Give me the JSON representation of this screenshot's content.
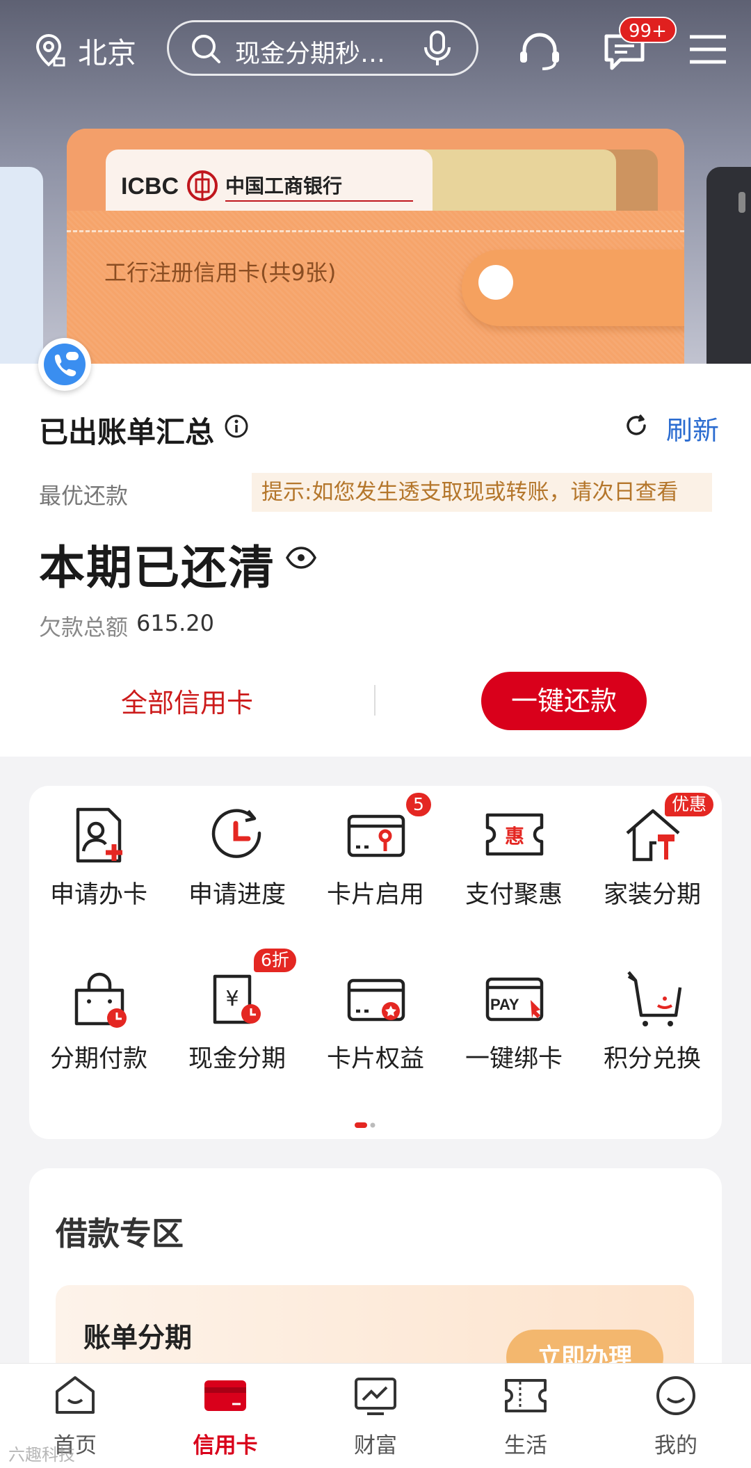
{
  "header": {
    "city": "北京",
    "search_placeholder": "现金分期秒…",
    "message_badge": "99+"
  },
  "wallet": {
    "bank_logo_text": "ICBC",
    "bank_name": "中国工商银行",
    "label": "工行注册信用卡(共9张)"
  },
  "bill": {
    "title": "已出账单汇总",
    "refresh": "刷新",
    "best_repay_label": "最优还款",
    "tip": "提示:如您发生透支取现或转账，请次日查看",
    "status": "本期已还清",
    "owed_label": "欠款总额",
    "owed_value": "615.20",
    "all_cards": "全部信用卡",
    "repay_button": "一键还款"
  },
  "grid": {
    "items": [
      {
        "label": "申请办卡",
        "icon": "apply-card-icon"
      },
      {
        "label": "申请进度",
        "icon": "progress-icon"
      },
      {
        "label": "卡片启用",
        "icon": "card-activate-icon",
        "badge": "5"
      },
      {
        "label": "支付聚惠",
        "icon": "payment-offer-icon"
      },
      {
        "label": "家装分期",
        "icon": "home-decor-icon",
        "badge": "优惠"
      },
      {
        "label": "分期付款",
        "icon": "installment-bag-icon"
      },
      {
        "label": "现金分期",
        "icon": "cash-installment-icon",
        "badge": "6折"
      },
      {
        "label": "卡片权益",
        "icon": "card-benefit-icon"
      },
      {
        "label": "一键绑卡",
        "icon": "pay-bind-icon"
      },
      {
        "label": "积分兑换",
        "icon": "points-cart-icon"
      }
    ],
    "page_dots": {
      "count": 2,
      "active": 1
    }
  },
  "loan": {
    "title": "借款专区",
    "card_title": "账单分期",
    "button": "立即办理"
  },
  "tabbar": {
    "tabs": [
      {
        "label": "首页",
        "icon": "home-icon"
      },
      {
        "label": "信用卡",
        "icon": "credit-card-icon",
        "active": true
      },
      {
        "label": "财富",
        "icon": "wealth-chart-icon"
      },
      {
        "label": "生活",
        "icon": "ticket-icon"
      },
      {
        "label": "我的",
        "icon": "smile-icon"
      }
    ]
  },
  "watermark": "六趣科技",
  "colors": {
    "accent": "#d9001b",
    "link": "#2b6cd0",
    "wallet": "#f6a46a"
  }
}
